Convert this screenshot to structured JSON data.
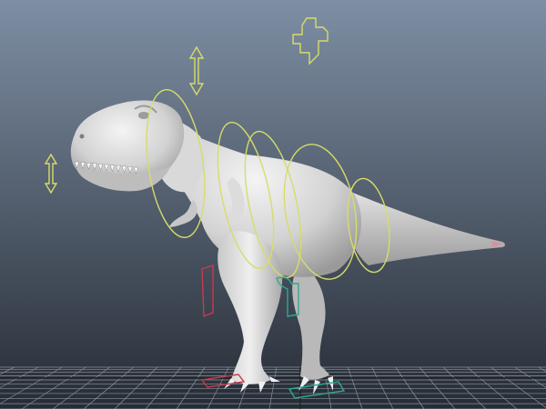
{
  "viewport": {
    "background_top": "#7e8fa4",
    "background_bottom": "#262c35"
  },
  "colors": {
    "rig_control": "#d7dc6a",
    "ik_left": "#c9394e",
    "ik_right": "#2fa890",
    "grid_line": "#8a919c",
    "grid_axis": "#202327",
    "model_light": "#f2f2f2",
    "model_mid": "#c8c8c8",
    "model_shadow": "#8b8b8b"
  },
  "scene": {
    "model": "dinosaur-model",
    "controls": [
      "head-move-arrow-icon",
      "jaw-move-arrow-icon",
      "root-cross-control-icon",
      "neck-ring-control",
      "spine-ring-control",
      "pelvis-ring-control",
      "tail-ring-control",
      "left-leg-ik-control",
      "right-leg-ik-control"
    ]
  }
}
